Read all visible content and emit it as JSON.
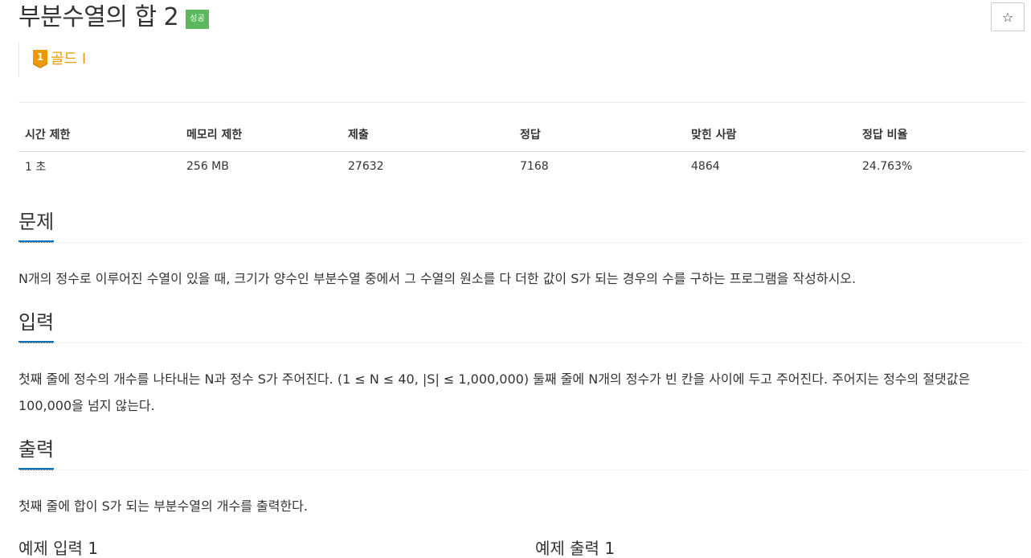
{
  "problem": {
    "title": "부분수열의 합 2",
    "status_badge": "성공",
    "star_icon": "☆",
    "tier": {
      "level": "1",
      "label": "골드 I",
      "color": "#ec9a00"
    }
  },
  "info_table": {
    "headers": [
      "시간 제한",
      "메모리 제한",
      "제출",
      "정답",
      "맞힌 사람",
      "정답 비율"
    ],
    "values": [
      "1 초",
      "256 MB",
      "27632",
      "7168",
      "4864",
      "24.763%"
    ]
  },
  "sections": {
    "problem": {
      "title": "문제",
      "text": "N개의 정수로 이루어진 수열이 있을 때, 크기가 양수인 부분수열 중에서 그 수열의 원소를 다 더한 값이 S가 되는 경우의 수를 구하는 프로그램을 작성하시오."
    },
    "input": {
      "title": "입력",
      "text": "첫째 줄에 정수의 개수를 나타내는 N과 정수 S가 주어진다. (1 ≤ N ≤ 40, |S| ≤ 1,000,000) 둘째 줄에 N개의 정수가 빈 칸을 사이에 두고 주어진다. 주어지는 정수의 절댓값은 100,000을 넘지 않는다."
    },
    "output": {
      "title": "출력",
      "text": "첫째 줄에 합이 S가 되는 부분수열의 개수를 출력한다."
    }
  },
  "samples": {
    "input_title": "예제 입력 1",
    "output_title": "예제 출력 1"
  },
  "colors": {
    "badge_success": "#5cb85c",
    "section_underline": "#0076c0",
    "tier_gold": "#ec9a00"
  }
}
